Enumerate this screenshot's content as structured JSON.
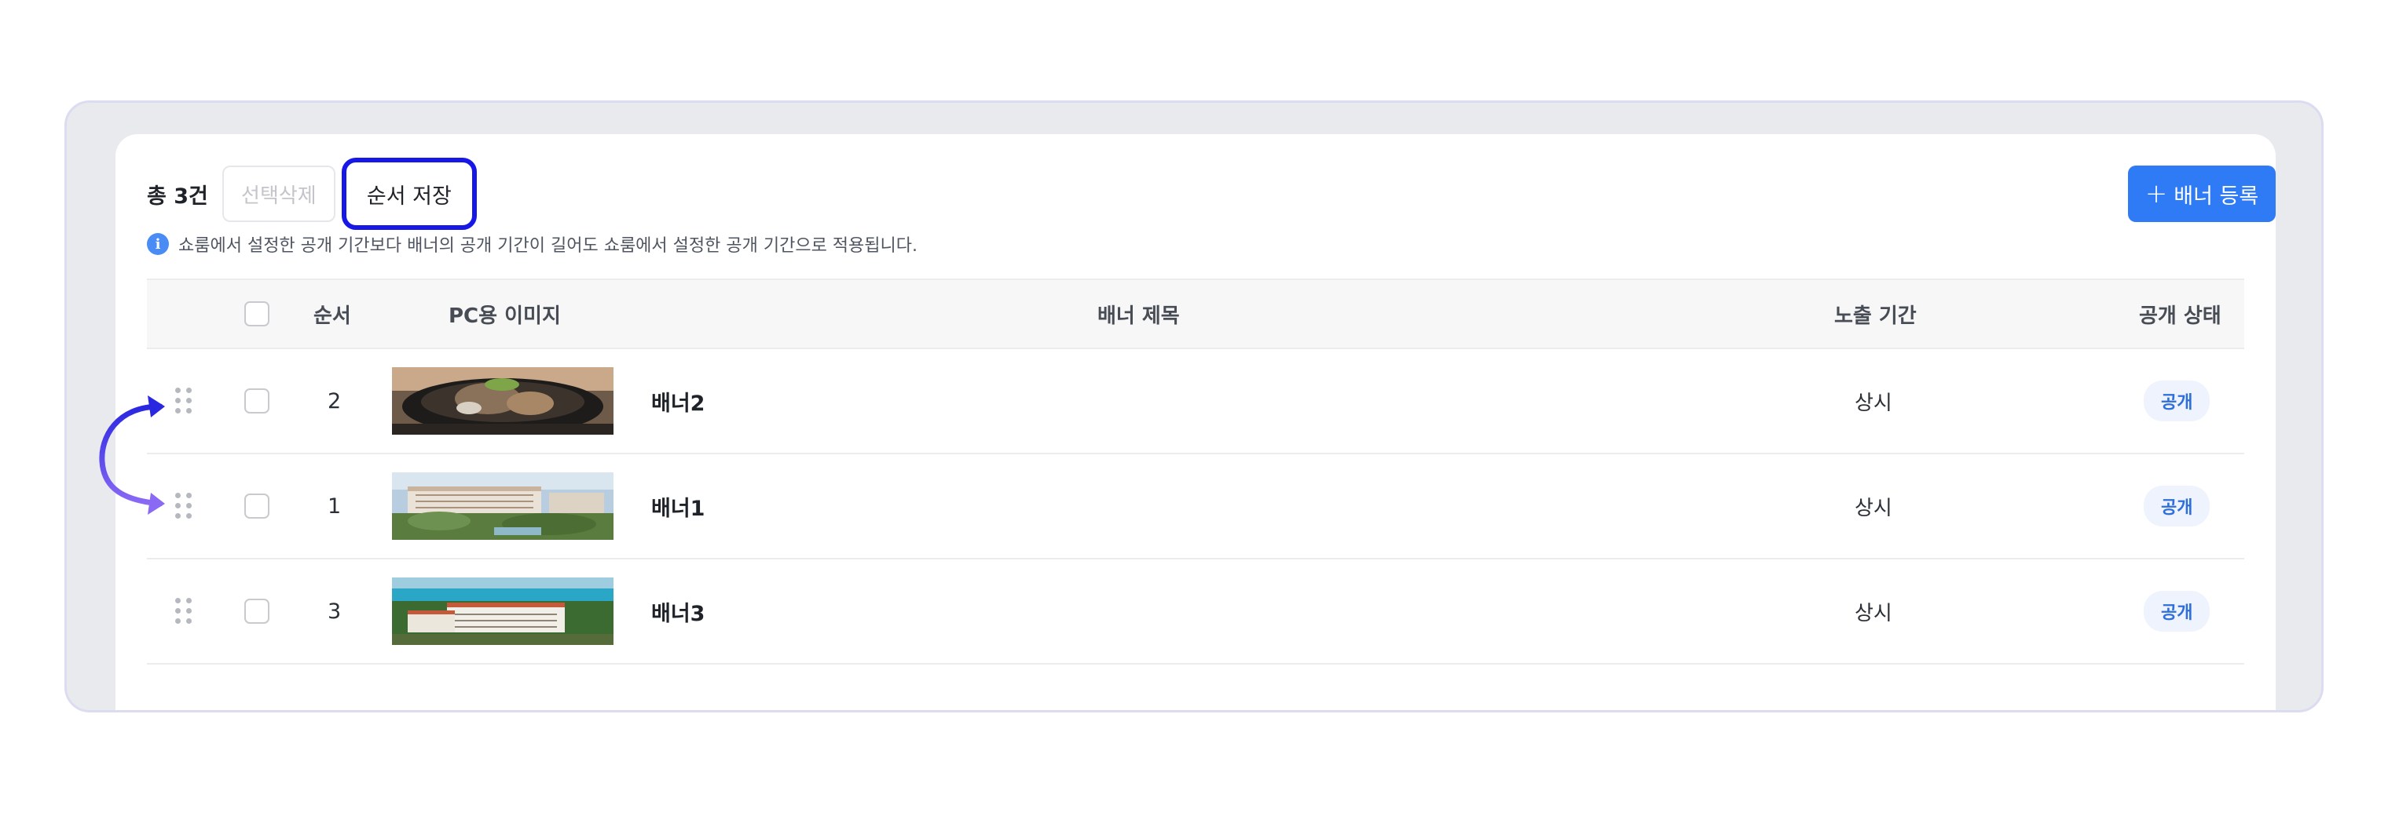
{
  "toolbar": {
    "total": "총 3건",
    "delete_label": "선택삭제",
    "save_order_label": "순서 저장",
    "add_label": "배너 등록",
    "add_icon": "plus-icon"
  },
  "notice": {
    "icon": "info-icon",
    "text": "쇼룸에서 설정한 공개 기간보다 배너의 공개 기간이 길어도 쇼룸에서 설정한 공개 기간으로 적용됩니다."
  },
  "table": {
    "headers": {
      "order": "순서",
      "pc_image": "PC용 이미지",
      "title": "배너 제목",
      "period": "노출 기간",
      "status": "공개 상태"
    },
    "rows": [
      {
        "order": "2",
        "title": "배너2",
        "period": "상시",
        "status": "공개",
        "image": "food-photo"
      },
      {
        "order": "1",
        "title": "배너1",
        "period": "상시",
        "status": "공개",
        "image": "resort-photo"
      },
      {
        "order": "3",
        "title": "배너3",
        "period": "상시",
        "status": "공개",
        "image": "seaside-hotel-photo"
      }
    ]
  },
  "colors": {
    "primary": "#2f7bf5",
    "highlight_border": "#1717e6",
    "arrow": "#4b3ef0",
    "badge_text": "#2f6fd9",
    "badge_bg": "#eef3fd"
  }
}
